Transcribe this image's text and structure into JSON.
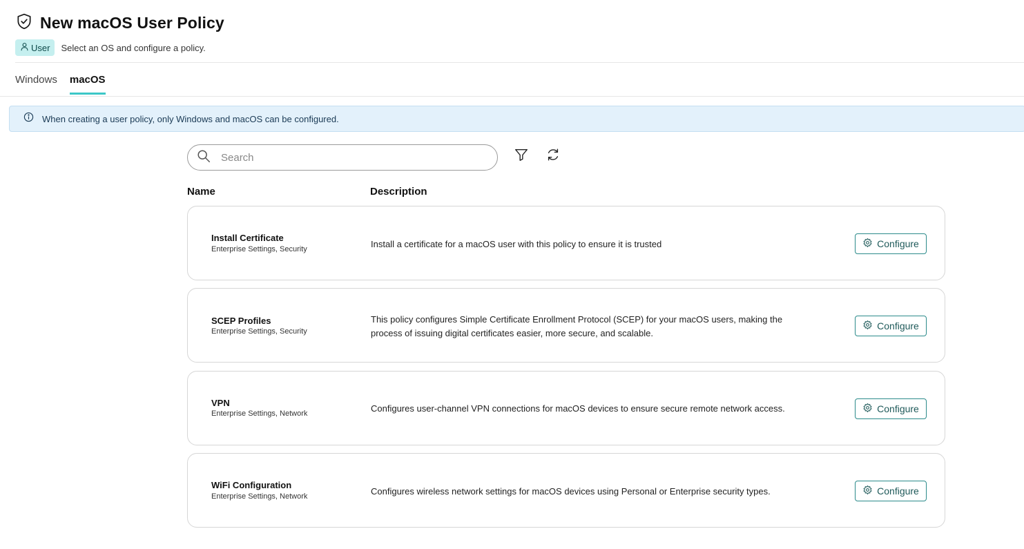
{
  "header": {
    "title": "New macOS User Policy",
    "badge_label": "User",
    "subtitle": "Select an OS and configure a policy."
  },
  "tabs": [
    {
      "label": "Windows",
      "active": false
    },
    {
      "label": "macOS",
      "active": true
    }
  ],
  "info_bar": {
    "text": "When creating a user policy, only Windows and macOS can be configured."
  },
  "search": {
    "placeholder": "Search",
    "value": ""
  },
  "columns": {
    "name": "Name",
    "description": "Description"
  },
  "policies": [
    {
      "name": "Install Certificate",
      "tags": "Enterprise Settings, Security",
      "description": "Install a certificate for a macOS user with this policy to ensure it is trusted",
      "action": "Configure"
    },
    {
      "name": "SCEP Profiles",
      "tags": "Enterprise Settings, Security",
      "description": "This policy configures Simple Certificate Enrollment Protocol (SCEP) for your macOS users, making the process of issuing digital certificates easier, more secure, and scalable.",
      "action": "Configure"
    },
    {
      "name": "VPN",
      "tags": "Enterprise Settings, Network",
      "description": "Configures user-channel VPN connections for macOS devices to ensure secure remote network access.",
      "action": "Configure"
    },
    {
      "name": "WiFi Configuration",
      "tags": "Enterprise Settings, Network",
      "description": "Configures wireless network settings for macOS devices using Personal or Enterprise security types.",
      "action": "Configure"
    }
  ],
  "colors": {
    "accent": "#3cc7c7",
    "badge_bg": "#c5efef",
    "info_bg": "#e3f1fb",
    "button_border": "#2a8a8a"
  },
  "icons": {
    "title": "shield-check-icon",
    "badge": "user-icon",
    "info": "info-icon",
    "search": "search-icon",
    "filter": "filter-icon",
    "refresh": "refresh-icon",
    "configure": "gear-icon"
  }
}
